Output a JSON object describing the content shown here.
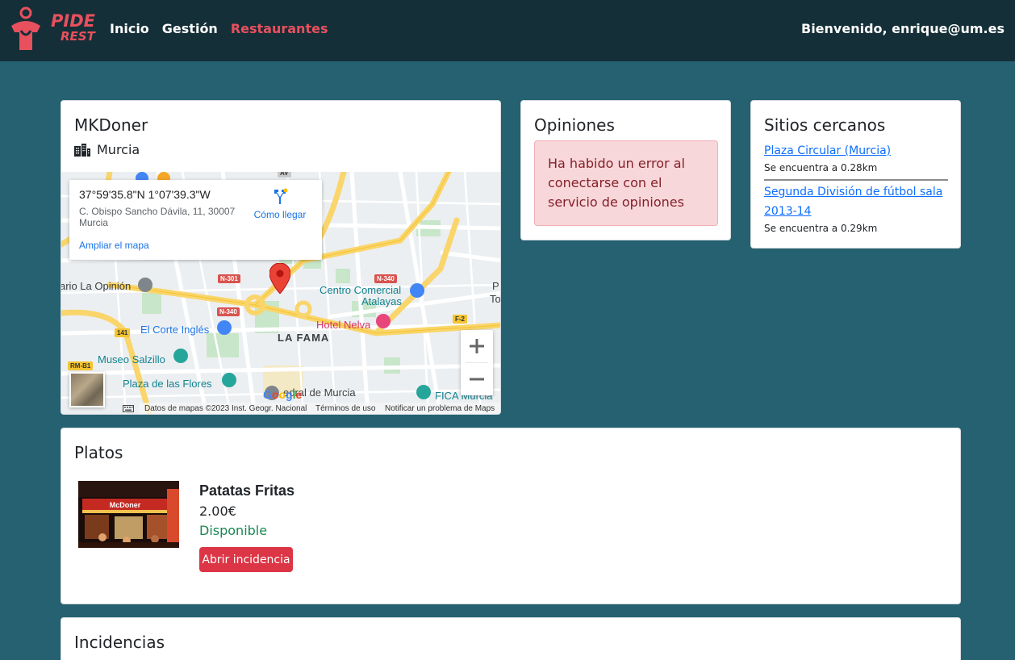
{
  "brand": {
    "line1": "PIDE",
    "line2": "REST",
    "color": "#e8505e"
  },
  "nav": {
    "items": [
      {
        "label": "Inicio"
      },
      {
        "label": "Gestión"
      },
      {
        "label": "Restaurantes"
      }
    ],
    "welcome": "Bienvenido, enrique@um.es"
  },
  "restaurant": {
    "name": "MKDoner",
    "city": "Murcia",
    "map": {
      "coords": "37°59'35.8\"N 1°07'39.3\"W",
      "address_line1": "C. Obispo Sancho Dávila, 11, 30007",
      "address_line2": "Murcia",
      "directions": "Cómo llegar",
      "enlarge": "Ampliar el mapa",
      "labels": {
        "opinion": "ario La Opinión",
        "centro_comercial": "Centro Comercial",
        "atalayas": "Atalayas",
        "hotel": "Hotel Nelva",
        "corte_ingles": "El Corte Inglés",
        "la_fama": "LA FAMA",
        "museo": "Museo Salzillo",
        "plaza": "Plaza de las Flores",
        "catedral": "edral de Murcia",
        "fica": "FICA Murcia",
        "edge_p": "P",
        "edge_t": "To"
      },
      "roads": {
        "n301": "N-301",
        "n340a": "N-340",
        "n340b": "N-340",
        "f2": "F-2",
        "r141": "141",
        "rmb1": "RM-B1",
        "av": "AV"
      },
      "attribution": {
        "data": "Datos de mapas ©2023 Inst. Geogr. Nacional",
        "terms": "Términos de uso",
        "report": "Notificar un problema de Maps"
      },
      "google": "Google"
    }
  },
  "opinions": {
    "title": "Opiniones",
    "error": "Ha habido un error al conectarse con el servicio de opiniones"
  },
  "nearby": {
    "title": "Sitios cercanos",
    "items": [
      {
        "name": "Plaza Circular (Murcia)",
        "distance": "Se encuentra a 0.28km"
      },
      {
        "name": "Segunda División de fútbol sala 2013-14",
        "distance": "Se encuentra a 0.29km"
      }
    ]
  },
  "dishes": {
    "title": "Platos",
    "items": [
      {
        "name": "Patatas Fritas",
        "price": "2.00€",
        "status": "Disponible",
        "action": "Abrir incidencia",
        "image_sign": "McDoner"
      }
    ]
  },
  "incidents": {
    "title": "Incidencias"
  }
}
